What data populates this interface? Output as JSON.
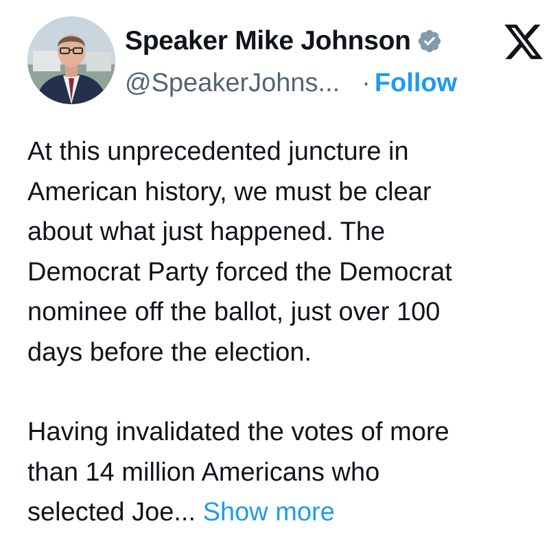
{
  "author": {
    "display_name": "Speaker Mike Johnson",
    "handle": "@SpeakerJohns...",
    "verified_icon": "verified-badge-icon",
    "verified_color": "#829aab",
    "avatar_icon": "profile-photo-avatar"
  },
  "actions": {
    "separator": "·",
    "follow_label": "Follow",
    "link_color": "#1d9bf0"
  },
  "platform": {
    "logo_icon": "x-logo-icon"
  },
  "tweet": {
    "paragraph_1_lines": [
      "At this unprecedented juncture in",
      "American history, we must be clear",
      "about what just happened. The",
      "Democrat Party forced the Democrat",
      "nominee off the ballot, just over 100",
      "days before the election."
    ],
    "paragraph_2_lines": [
      "Having invalidated the votes of more",
      "than 14 million Americans who",
      "selected Joe..."
    ],
    "show_more_label": "Show more"
  }
}
